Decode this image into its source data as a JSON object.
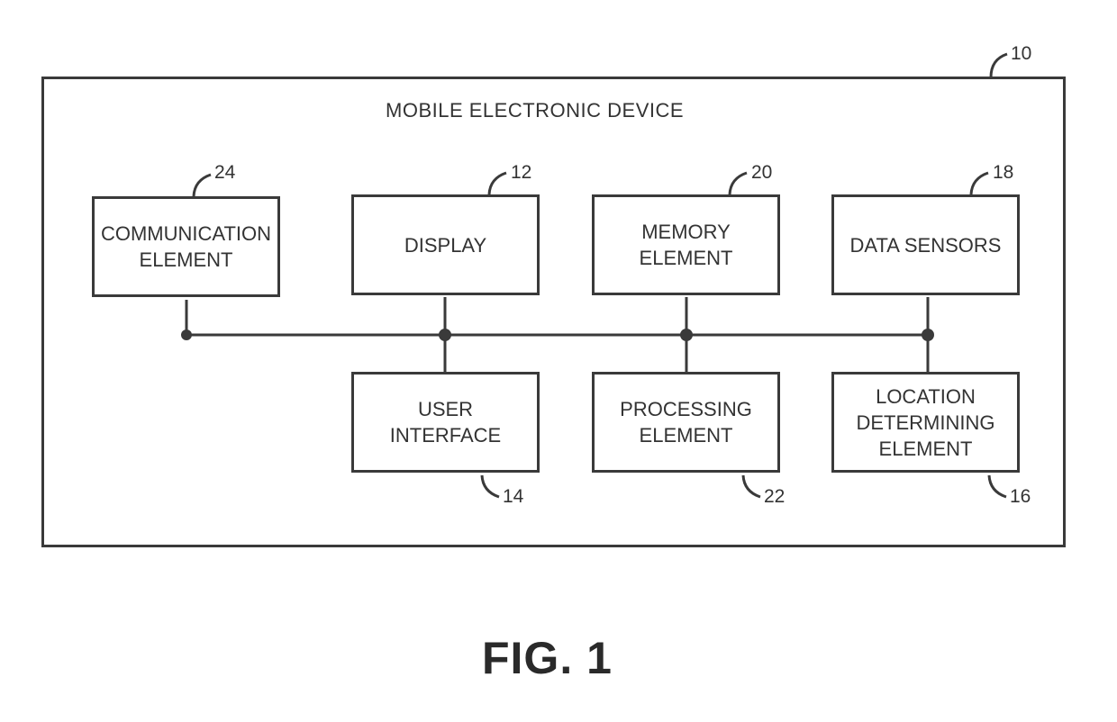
{
  "diagram": {
    "container": {
      "label": "MOBILE ELECTRONIC DEVICE",
      "ref": "10"
    },
    "blocks": [
      {
        "id": "communication",
        "label": "COMMUNICATION\nELEMENT",
        "ref": "24"
      },
      {
        "id": "display",
        "label": "DISPLAY",
        "ref": "12"
      },
      {
        "id": "memory",
        "label": "MEMORY\nELEMENT",
        "ref": "20"
      },
      {
        "id": "data-sensors",
        "label": "DATA SENSORS",
        "ref": "18"
      },
      {
        "id": "user-interface",
        "label": "USER\nINTERFACE",
        "ref": "14"
      },
      {
        "id": "processing",
        "label": "PROCESSING\nELEMENT",
        "ref": "22"
      },
      {
        "id": "location",
        "label": "LOCATION\nDETERMINING\nELEMENT",
        "ref": "16"
      }
    ],
    "connections": "All blocks connected via a common bus",
    "caption": "FIG. 1"
  }
}
